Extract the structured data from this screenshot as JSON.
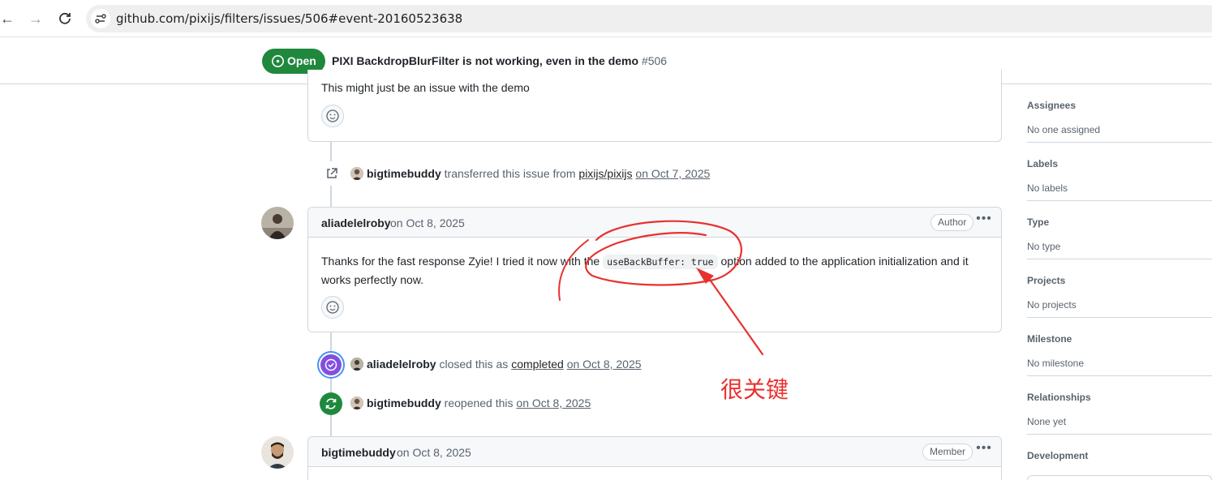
{
  "browser": {
    "url": "github.com/pixijs/filters/issues/506#event-20160523638"
  },
  "issue": {
    "state": "Open",
    "title": "PIXI BackdropBlurFilter is not working, even in the demo",
    "number": "#506"
  },
  "comment_partial": {
    "body": "This might just be an issue with the demo"
  },
  "event_transfer": {
    "user": "bigtimebuddy",
    "action": "transferred this issue from",
    "source": "pixijs/pixijs",
    "date": "on Oct 7, 2025"
  },
  "comment_author": {
    "author": "aliadelelroby",
    "date": "on Oct 8, 2025",
    "role": "Author",
    "body_before": "Thanks for the fast response Zyie! I tried it now with the",
    "code": "useBackBuffer: true",
    "body_after": "option added to the application initialization and it",
    "body_line2": "works perfectly now."
  },
  "event_closed": {
    "user": "aliadelelroby",
    "action": "closed this as",
    "reason": "completed",
    "date": "on Oct 8, 2025"
  },
  "event_reopened": {
    "user": "bigtimebuddy",
    "action": "reopened this",
    "date": "on Oct 8, 2025"
  },
  "comment_member": {
    "author": "bigtimebuddy",
    "date": "on Oct 8, 2025",
    "role": "Member"
  },
  "sidebar": {
    "sections": [
      {
        "title": "Assignees",
        "value": "No one assigned"
      },
      {
        "title": "Labels",
        "value": "No labels"
      },
      {
        "title": "Type",
        "value": "No type"
      },
      {
        "title": "Projects",
        "value": "No projects"
      },
      {
        "title": "Milestone",
        "value": "No milestone"
      },
      {
        "title": "Relationships",
        "value": "None yet"
      },
      {
        "title": "Development",
        "value": ""
      }
    ]
  },
  "annotation": {
    "text": "很关键",
    "color": "#e8312f"
  },
  "colors": {
    "open_green": "#1f883d",
    "closed_purple": "#8250df",
    "border": "#d0d7de",
    "muted_text": "#59636e"
  }
}
